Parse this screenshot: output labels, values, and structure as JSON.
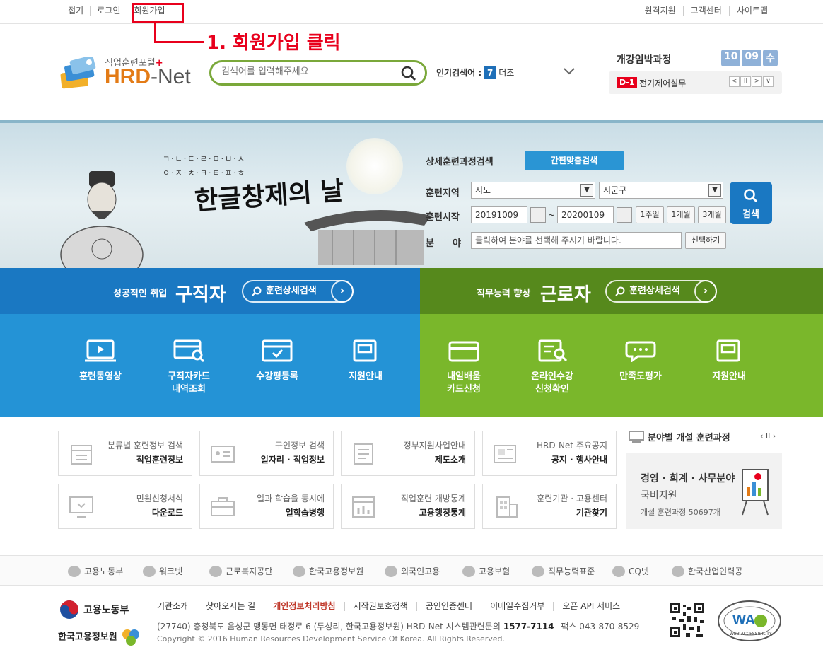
{
  "topbar": {
    "left_links": [
      "- 접기",
      "로그인",
      "회원가입"
    ],
    "right_links": [
      "원격지원",
      "고객센터",
      "사이트맵"
    ]
  },
  "annotation": {
    "text": "1. 회원가입 클릭",
    "color": "#e8001c"
  },
  "logo": {
    "subtitle": "직업훈련포털",
    "plus": "+",
    "name_hrd": "HRD",
    "name_net": "-Net"
  },
  "search": {
    "placeholder": "검색어를 입력해주세요"
  },
  "popular": {
    "label": "인기검색어 :",
    "rank": "7",
    "keyword": "더조"
  },
  "opening": {
    "title": "개강임박과정",
    "month": "10",
    "day": "09",
    "weekday": "수",
    "dday": "D-1",
    "course": "전기제어실무",
    "controls": [
      "<",
      "II",
      ">",
      "∨"
    ]
  },
  "banner": {
    "small_text_1": "ㄱ·ㄴ·ㄷ·ㄹ·ㅁ·ㅂ·ㅅ",
    "small_text_2": "ㅇ·ㅈ·ㅊ·ㅋ·ㅌ·ㅍ·ㅎ",
    "title": "한글창제의 날"
  },
  "detail_search": {
    "title": "상세훈련과정검색",
    "simple_button": "간편맞춤검색",
    "region_label": "훈련지역",
    "region_sido": "시도",
    "region_sigungu": "시군구",
    "start_label": "훈련시작",
    "date_from": "20191009",
    "date_sep": "~",
    "date_to": "20200109",
    "periods": [
      "1주일",
      "1개월",
      "3개월"
    ],
    "field_label_1": "분",
    "field_label_2": "야",
    "field_placeholder": "클릭하여 분야를 선택해 주시기 바랍니다.",
    "field_button": "선택하기",
    "search_button": "검색"
  },
  "jobseeker": {
    "tag": "성공적인 취업",
    "title": "구직자",
    "pill": "훈련상세검색",
    "items": [
      {
        "line1": "훈련동영상",
        "line2": ""
      },
      {
        "line1": "구직자카드",
        "line2": "내역조회"
      },
      {
        "line1": "수강평등록",
        "line2": ""
      },
      {
        "line1": "지원안내",
        "line2": ""
      }
    ]
  },
  "worker": {
    "tag": "직무능력 향상",
    "title": "근로자",
    "pill": "훈련상세검색",
    "items": [
      {
        "line1": "내일배움",
        "line2": "카드신청"
      },
      {
        "line1": "온라인수강",
        "line2": "신청확인"
      },
      {
        "line1": "만족도평가",
        "line2": ""
      },
      {
        "line1": "지원안내",
        "line2": ""
      }
    ]
  },
  "quick": [
    {
      "sub": "분류별 훈련정보 검색",
      "main": "직업훈련정보"
    },
    {
      "sub": "구인정보 검색",
      "main": "일자리 · 직업정보"
    },
    {
      "sub": "정부지원사업안내",
      "main": "제도소개"
    },
    {
      "sub": "HRD-Net 주요공지",
      "main": "공지 · 행사안내"
    },
    {
      "sub": "민원신청서식",
      "main": "다운로드"
    },
    {
      "sub": "일과 학습을 동시에",
      "main": "일학습병행"
    },
    {
      "sub": "직업훈련 개방통계",
      "main": "고용행정통계"
    },
    {
      "sub": "훈련기관 · 고용센터",
      "main": "기관찾기"
    }
  ],
  "field_courses": {
    "title": "분야별 개설 훈련과정",
    "controls": "‹ II ›",
    "line1": "경영 · 회계 · 사무분야",
    "line2": "국비지원",
    "line3": "개설 훈련과정 50697개"
  },
  "orgs": [
    "고용노동부",
    "워크넷",
    "근로복지공단",
    "한국고용정보원",
    "외국인고용",
    "고용보험",
    "직무능력표준",
    "CQ넷",
    "한국산업인력공"
  ],
  "footer": {
    "ministry": "고용노동부",
    "agency": "한국고용정보원",
    "links": [
      "기관소개",
      "찾아오시는 길",
      "개인정보처리방침",
      "저작권보호정책",
      "공인인증센터",
      "이메일수집거부",
      "오픈 API 서비스"
    ],
    "address": "(27740) 충청북도 음성군 맹동면 태정로 6 (두성리, 한국고용정보원) HRD-Net 시스템관련문의",
    "phone": "1577-7114",
    "fax": "팩스 043-870-8529",
    "copyright": "Copyright © 2016 Human Resources Development Service Of Korea. All Rights Reserved.",
    "wa_text": "WA",
    "wa_sub": "WEB ACCESSIBILITY"
  }
}
